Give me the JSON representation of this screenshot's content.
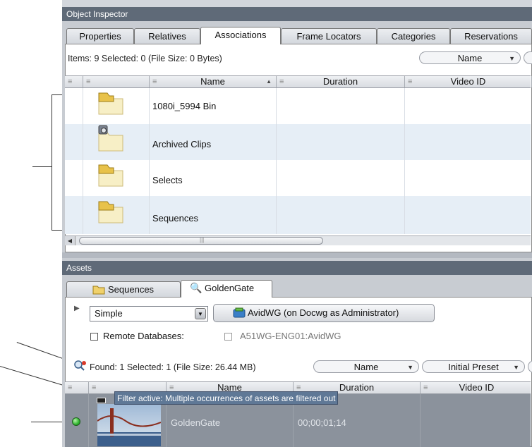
{
  "object_inspector": {
    "title": "Object Inspector",
    "tabs": [
      "Properties",
      "Relatives",
      "Associations",
      "Frame Locators",
      "Categories",
      "Reservations"
    ],
    "active_tab": "Associations",
    "status": "Items: 9 Selected: 0 (File Size: 0 Bytes)",
    "sort_field": "Name",
    "columns": [
      "Name",
      "Duration",
      "Video ID"
    ],
    "column_grip": "≡",
    "rows": [
      {
        "name": "1080i_5994 Bin",
        "icon": "folder-icon"
      },
      {
        "name": "Archived Clips",
        "icon": "archived-folder-icon"
      },
      {
        "name": "Selects",
        "icon": "folder-icon"
      },
      {
        "name": "Sequences",
        "icon": "folder-icon"
      }
    ]
  },
  "assets": {
    "title": "Assets",
    "tabs": [
      "Sequences",
      "GoldenGate"
    ],
    "active_tab": "GoldenGate",
    "search_mode": "Simple",
    "database_button": "AvidWG (on Docwg as Administrator)",
    "remote_databases_label": "Remote Databases:",
    "remote_database_option": "A51WG-ENG01:AvidWG",
    "status": "Found: 1 Selected: 1 (File Size: 26.44 MB)",
    "sort_field": "Name",
    "preset_field": "Initial Preset",
    "columns": [
      "Name",
      "Duration",
      "Video ID"
    ],
    "column_grip": "≡",
    "tooltip": "Filter active: Multiple occurrences of assets are filtered out",
    "rows": [
      {
        "name": "GoldenGate",
        "duration": "00;00;01;14",
        "status": "online"
      }
    ]
  },
  "colors": {
    "panel_header": "#5f6a78",
    "row_alt": "#e6eef6",
    "selected_row": "#8b929c",
    "tooltip_bg": "#5f7896",
    "status_green": "#2fb62f"
  }
}
